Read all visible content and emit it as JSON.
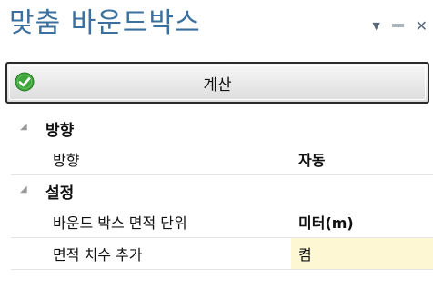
{
  "panel": {
    "title": "맞춤 바운드박스",
    "controls": {
      "dropdown_icon": "▼",
      "pin_icon": "ᆍ",
      "close_icon": "✕"
    }
  },
  "calculate_button": {
    "label": "계산",
    "icon": "check-circle-icon",
    "icon_color": "#3ea63a"
  },
  "property_grid": {
    "categories": [
      {
        "label": "방향",
        "properties": [
          {
            "name": "방향",
            "value": "자동"
          }
        ]
      },
      {
        "label": "설정",
        "properties": [
          {
            "name": "바운드 박스 면적 단위",
            "value": "미터(m)"
          },
          {
            "name": "면적 치수 추가",
            "value": "켬"
          }
        ]
      }
    ],
    "collapse_icon": "◢",
    "highlight_color": "#fdf8d3"
  }
}
